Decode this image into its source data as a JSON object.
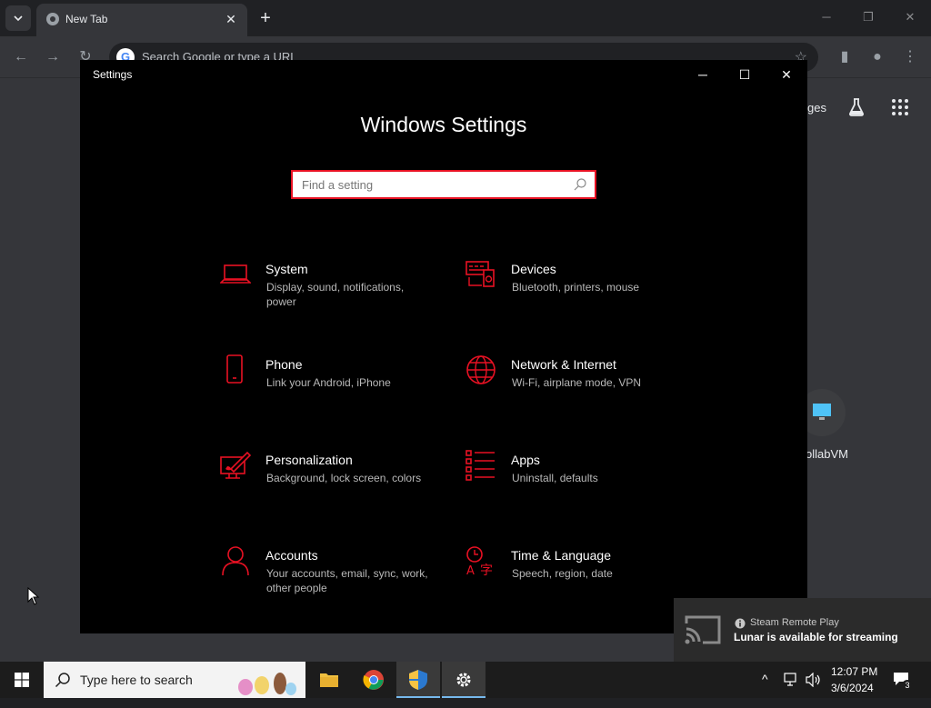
{
  "chrome": {
    "tab_title": "New Tab",
    "omnibox_placeholder": "Search Google or type a URL",
    "ntp_link_partial": "ges",
    "shortcut_label": "ollabVM"
  },
  "settings": {
    "window_title": "Settings",
    "heading": "Windows Settings",
    "search_placeholder": "Find a setting",
    "accent": "#e81123",
    "categories": [
      {
        "title": "System",
        "desc": "Display, sound, notifications, power",
        "icon": "laptop-icon"
      },
      {
        "title": "Devices",
        "desc": "Bluetooth, printers, mouse",
        "icon": "devices-icon"
      },
      {
        "title": "Phone",
        "desc": "Link your Android, iPhone",
        "icon": "phone-icon"
      },
      {
        "title": "Network & Internet",
        "desc": "Wi-Fi, airplane mode, VPN",
        "icon": "globe-icon"
      },
      {
        "title": "Personalization",
        "desc": "Background, lock screen, colors",
        "icon": "paint-icon"
      },
      {
        "title": "Apps",
        "desc": "Uninstall, defaults",
        "icon": "apps-list-icon"
      },
      {
        "title": "Accounts",
        "desc": "Your accounts, email, sync, work, other people",
        "icon": "person-icon"
      },
      {
        "title": "Time & Language",
        "desc": "Speech, region, date",
        "icon": "time-language-icon"
      }
    ]
  },
  "toast": {
    "app": "Steam Remote Play",
    "message": "Lunar is available for streaming"
  },
  "taskbar": {
    "search_placeholder": "Type here to search",
    "time": "12:07 PM",
    "date": "3/6/2024",
    "notification_count": "3"
  }
}
